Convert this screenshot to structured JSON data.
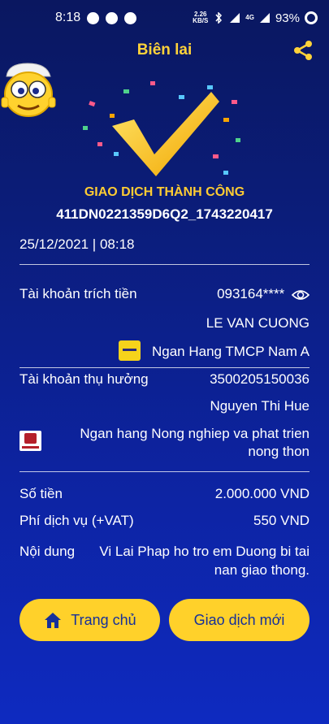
{
  "status_bar": {
    "time": "8:18",
    "net_speed_value": "2.26",
    "net_speed_unit": "KB/S",
    "network": "4G",
    "battery": "93%"
  },
  "header": {
    "title": "Biên lai"
  },
  "receipt": {
    "status": "GIAO DỊCH THÀNH CÔNG",
    "transaction_id": "411DN0221359D6Q2_1743220417",
    "datetime": "25/12/2021 | 08:18",
    "source_account_label": "Tài khoản trích tiền",
    "source_account_number": "093164****",
    "source_account_name": "LE VAN CUONG",
    "source_bank": "Ngan Hang TMCP Nam A",
    "beneficiary_label": "Tài khoản thụ hưởng",
    "beneficiary_account_number": "3500205150036",
    "beneficiary_name": "Nguyen Thi Hue",
    "beneficiary_bank_line1": "Ngan hang Nong nghiep va phat trien",
    "beneficiary_bank_line2": "nong thon",
    "amount_label": "Số tiền",
    "amount_value": "2.000.000 VND",
    "fee_label": "Phí dịch vụ (+VAT)",
    "fee_value": "550 VND",
    "content_label": "Nội dung",
    "content_line1": "Vi Lai Phap ho tro em Duong bi tai",
    "content_line2": "nan giao thong."
  },
  "actions": {
    "home_label": "Trang chủ",
    "new_transaction_label": "Giao dịch mới"
  },
  "colors": {
    "accent_yellow": "#ffd12a",
    "title_yellow": "#ffd23a",
    "background_top": "#0a1760",
    "background_bottom": "#0e2ac0",
    "button_text": "#16309a"
  },
  "icons": {
    "share": "share-icon",
    "eye": "eye-icon",
    "home": "home-icon",
    "checkmark": "checkmark-icon"
  }
}
